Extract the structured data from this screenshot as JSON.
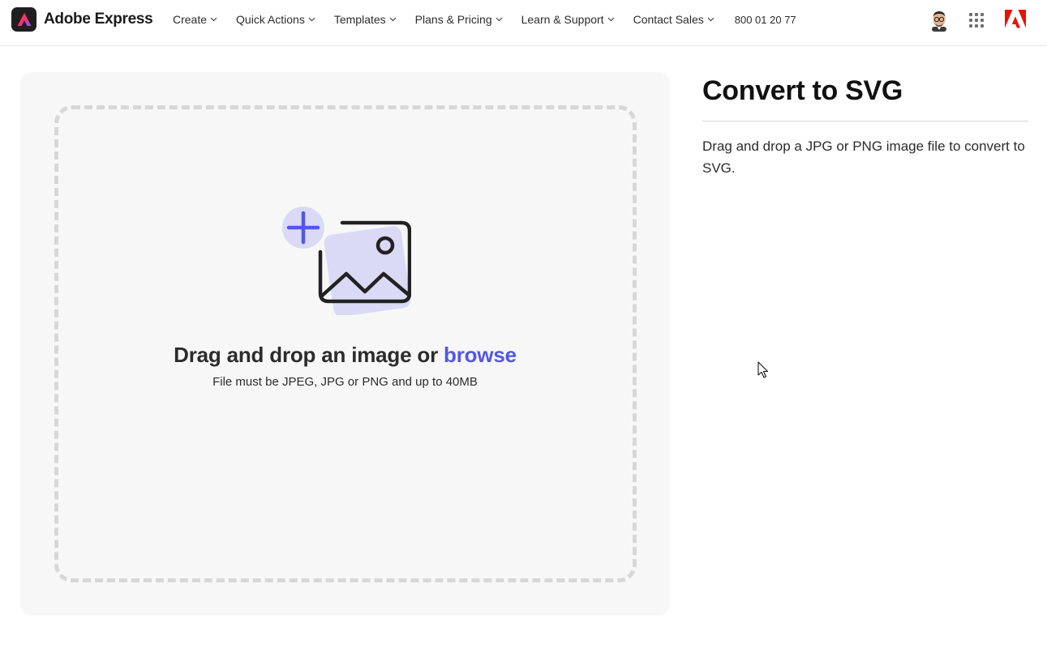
{
  "header": {
    "brand_name": "Adobe Express",
    "nav": [
      {
        "label": "Create"
      },
      {
        "label": "Quick Actions"
      },
      {
        "label": "Templates"
      },
      {
        "label": "Plans & Pricing"
      },
      {
        "label": "Learn & Support"
      },
      {
        "label": "Contact Sales"
      }
    ],
    "phone": "800 01 20 77",
    "icons": {
      "brand": "adobe-express-logo",
      "avatar": "user-avatar",
      "apps": "app-switcher-grid-icon",
      "adobe": "adobe-logo"
    }
  },
  "upload": {
    "heading_prefix": "Drag and drop an image or",
    "browse_label": "browse",
    "subtext": "File must be JPEG, JPG or PNG and up to 40MB",
    "illustration_icon": "add-image-icon"
  },
  "panel": {
    "title": "Convert to SVG",
    "description": "Drag and drop a JPG or PNG image file to convert to SVG."
  },
  "colors": {
    "accent": "#5258e4",
    "illustration_tint": "#dadaf7",
    "panel_bg": "#f7f7f7",
    "dash_border": "#d7d7d7",
    "adobe_red": "#eb1000"
  }
}
